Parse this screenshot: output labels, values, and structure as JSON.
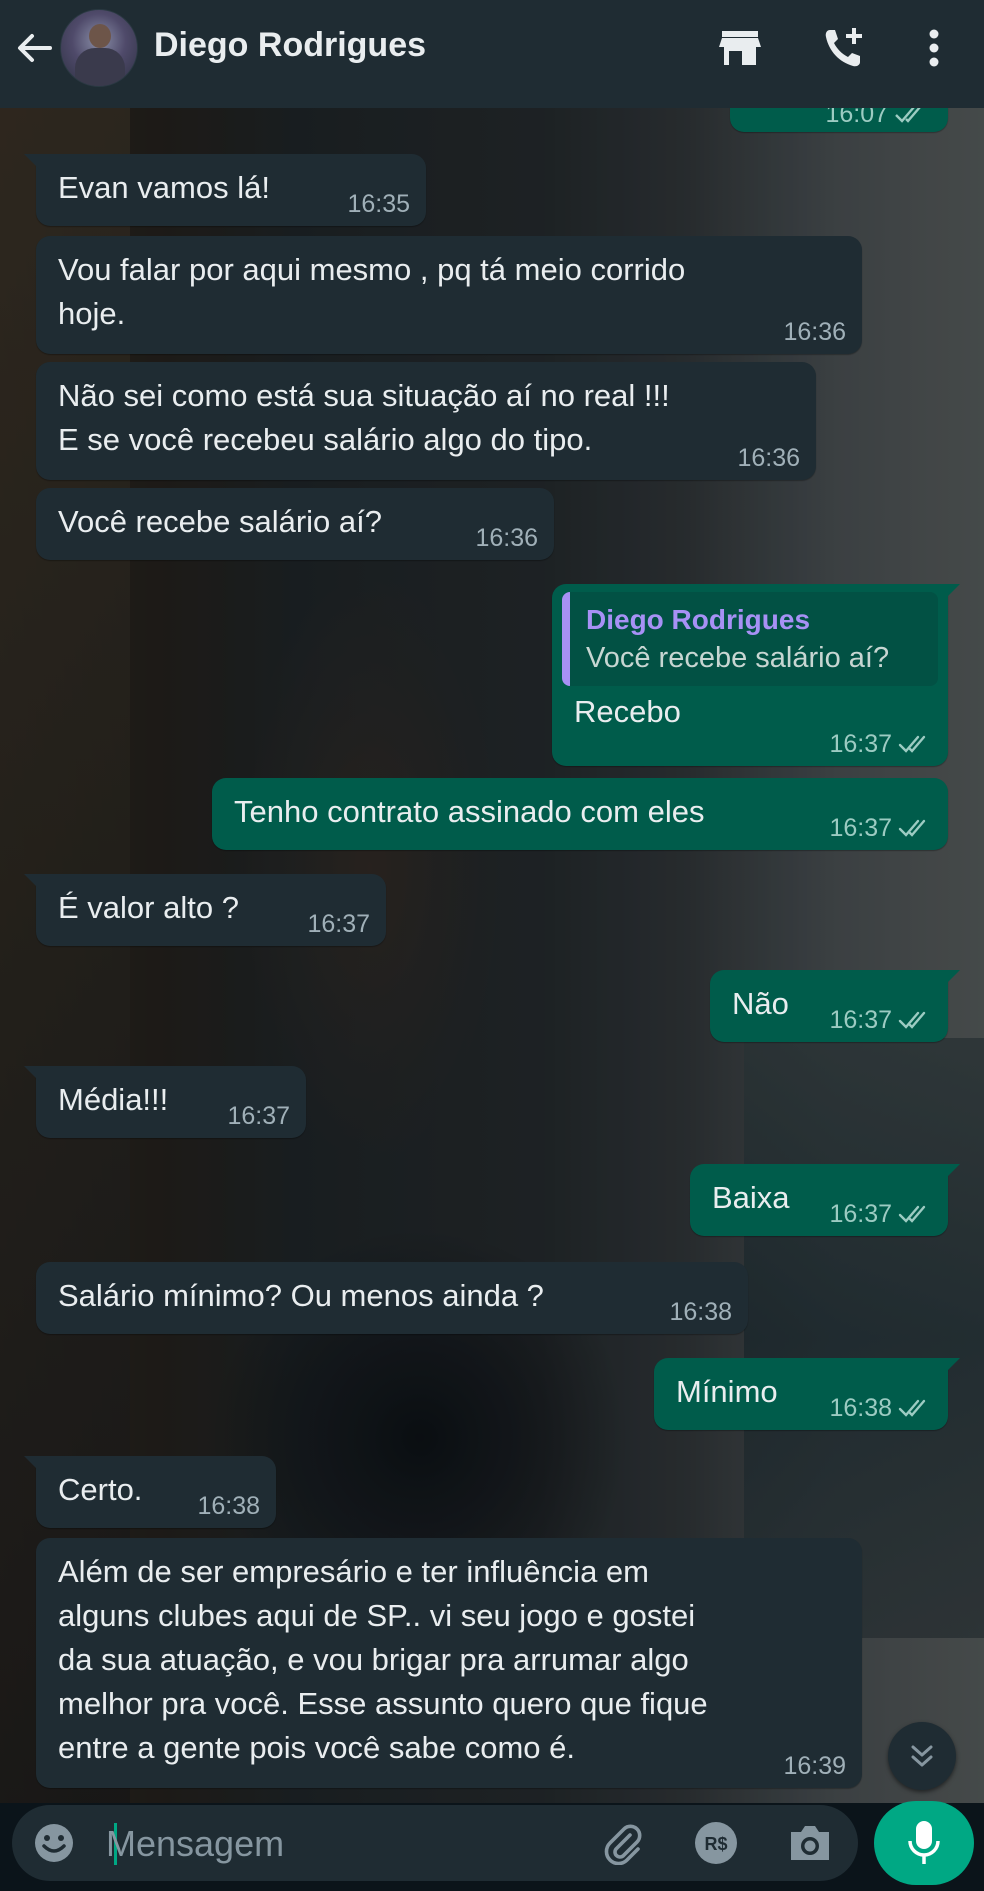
{
  "header": {
    "contact_name": "Diego Rodrigues",
    "icons": [
      "back-arrow-icon",
      "store-icon",
      "add-call-icon",
      "more-vertical-icon"
    ]
  },
  "partial_top_time": "16:07",
  "messages": [
    {
      "dir": "in",
      "text": "Evan vamos lá!",
      "time": "16:35"
    },
    {
      "dir": "in",
      "text": "Vou falar por aqui mesmo , pq tá meio corrido\nhoje.",
      "time": "16:36"
    },
    {
      "dir": "in",
      "text": "Não sei como está sua situação aí no real !!!\nE se você recebeu salário algo do tipo.",
      "time": "16:36"
    },
    {
      "dir": "in",
      "text": "Você recebe salário aí?",
      "time": "16:36"
    },
    {
      "dir": "out",
      "quote_name": "Diego Rodrigues",
      "quote_text": "Você recebe salário aí?",
      "text": "Recebo",
      "time": "16:37"
    },
    {
      "dir": "out",
      "text": "Tenho contrato assinado com eles",
      "time": "16:37"
    },
    {
      "dir": "in",
      "text": "É valor alto ?",
      "time": "16:37"
    },
    {
      "dir": "out",
      "text": "Não",
      "time": "16:37"
    },
    {
      "dir": "in",
      "text": "Média!!!",
      "time": "16:37"
    },
    {
      "dir": "out",
      "text": "Baixa",
      "time": "16:37"
    },
    {
      "dir": "in",
      "text": "Salário mínimo? Ou menos ainda ?",
      "time": "16:38"
    },
    {
      "dir": "out",
      "text": "Mínimo",
      "time": "16:38"
    },
    {
      "dir": "in",
      "text": "Certo.",
      "time": "16:38"
    },
    {
      "dir": "in",
      "text": "Além de ser empresário e ter influência em\nalguns clubes aqui de SP.. vi seu jogo e gostei\nda sua atuação, e vou brigar pra arrumar algo\nmelhor pra você. Esse assunto quero que fique\nentre a gente pois você sabe como é.",
      "time": "16:39"
    }
  ],
  "composer": {
    "placeholder": "Mensagem",
    "icons": [
      "emoji-icon",
      "attach-icon",
      "payment-icon",
      "camera-icon",
      "mic-icon"
    ],
    "payment_label": "R$"
  },
  "colors": {
    "header_bg": "#1f2c33",
    "incoming_bubble": "#1f2c33",
    "outgoing_bubble": "#005c4b",
    "accent": "#00a884",
    "quote_author": "#a791f5",
    "read_ticks": "#9ccbc2"
  }
}
